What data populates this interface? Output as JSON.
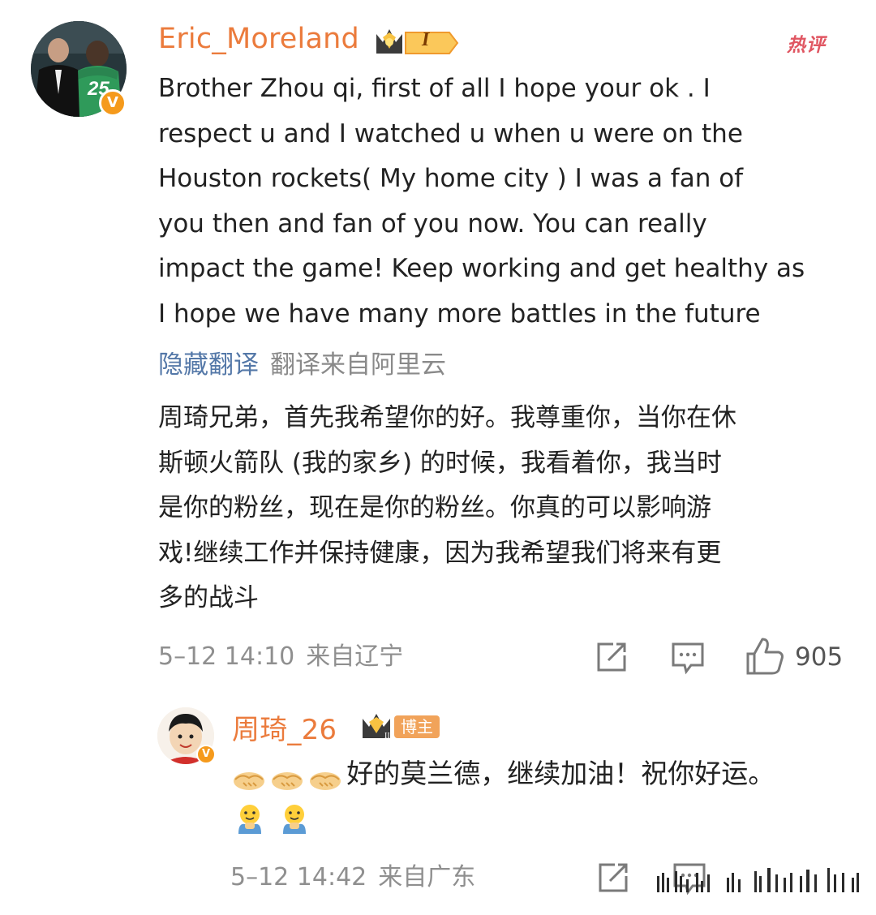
{
  "comment": {
    "username": "Eric_Moreland",
    "level_badge": "I",
    "hot_label": "热评",
    "text": "Brother Zhou qi, first of all I hope your ok . I\nrespect u and I watched u when u were on the\nHouston rockets( My home city ) I was a fan of\nyou then and fan of you now. You can really\nimpact the game! Keep working and get healthy as\nI hope we have many more battles in the future",
    "translate_toggle": "隐藏翻译",
    "translate_source": "翻译来自阿里云",
    "translation": "周琦兄弟，首先我希望你的好。我尊重你，当你在休\n斯顿火箭队 (我的家乡) 的时候，我看着你，我当时\n是你的粉丝，现在是你的粉丝。你真的可以影响游\n戏!继续工作并保持健康，因为我希望我们将来有更\n多的战斗",
    "date": "5–12 14:10",
    "location": "来自辽宁",
    "like_count": "905",
    "avatar_jersey": "25"
  },
  "reply": {
    "username": "周琦_26",
    "owner_tag": "博主",
    "text": "好的莫兰德，继续加油！祝你好运。",
    "date": "5–12 14:42",
    "location": "来自广东"
  },
  "icons": [
    "repost-icon",
    "comment-icon",
    "like-icon",
    "handshake-emoji",
    "fist-emoji",
    "verified-badge",
    "crown-badge"
  ],
  "colors": {
    "username": "#eb7b3c",
    "hot": "#e05662",
    "link": "#5478a8",
    "meta": "#8f8f8f",
    "verified": "#f59a1c"
  }
}
